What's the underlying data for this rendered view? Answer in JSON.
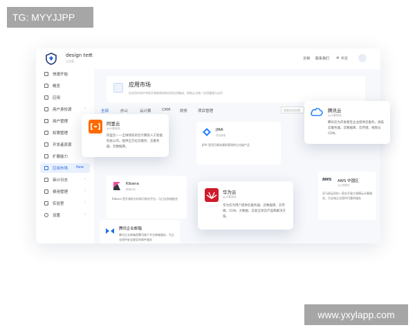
{
  "overlay": {
    "tag": "TG: MYYJJPP",
    "watermark": "www.yxylapp.com"
  },
  "topbar": {
    "workspace_name": "design test",
    "workspace_sub": "企业版",
    "links": [
      "文档",
      "联系我们",
      "中文"
    ]
  },
  "sidebar": {
    "items": [
      {
        "label": "快速开始"
      },
      {
        "label": "概览"
      },
      {
        "label": "应用"
      },
      {
        "label": "用户身份源"
      },
      {
        "label": "用户管理"
      },
      {
        "label": "权限管理"
      },
      {
        "label": "开发者资源"
      },
      {
        "label": "扩展能力"
      },
      {
        "label": "应用市场",
        "badge": "New"
      },
      {
        "label": "审计日志"
      },
      {
        "label": "费用管理"
      },
      {
        "label": "实验室"
      },
      {
        "label": "设置"
      }
    ]
  },
  "header": {
    "title": "应用市场",
    "desc": "在应用市场中寻找开源和原创的优质应用集成，帮助企业统一应用管理与访问"
  },
  "tabs": {
    "items": [
      "全部",
      "办公",
      "云计算",
      "CRM",
      "财务",
      "项目管理"
    ],
    "search_placeholder": "搜索应用名称"
  },
  "cards": {
    "jira": {
      "title": "JIRA",
      "sub": "项目管理",
      "desc": "JIRA 是项目事务跟踪管理的企业级产品"
    },
    "kibana": {
      "title": "Kibana",
      "sub": "数据分析",
      "desc": "Kibana 是开源的分析和可视化平台，与日志系统配合"
    },
    "aws": {
      "title": "AWS 中国区",
      "sub": "云计算服务",
      "desc": "亚马逊云科技一直在开展大规模云计算服务，为全球企业提供可靠的服务"
    },
    "qywx": {
      "title": "腾讯企业邮箱",
      "sub": "办公协同",
      "desc": "腾讯企业邮箱是腾讯旗下专业邮箱服务，为企业提供安全稳定的邮件服务"
    }
  },
  "float_cards": {
    "aliyun": {
      "title": "阿里云",
      "sub": "云计算服务",
      "desc": "阿里云——全球领先的云计算及人工智能科技公司，提供全方位云服务，云服务器，云数据库。"
    },
    "tencent": {
      "title": "腾讯云",
      "sub": "云计算服务",
      "desc": "腾讯云为开发者及企业提供云服务，涵盖云服务器、云数据库、云存储、视频与CDN。"
    },
    "huawei": {
      "title": "华为云",
      "sub": "云计算服务",
      "desc": "华为云为用户提供云服务器、云数据库、云存储、CDN、大数据、云安全等云产品和解决方案。"
    }
  },
  "colors": {
    "accent": "#2d6cdf",
    "aliyun": "#ff6a00",
    "huawei": "#cf1b2b",
    "jira": "#2684ff",
    "tencent": "#2f85f7"
  }
}
